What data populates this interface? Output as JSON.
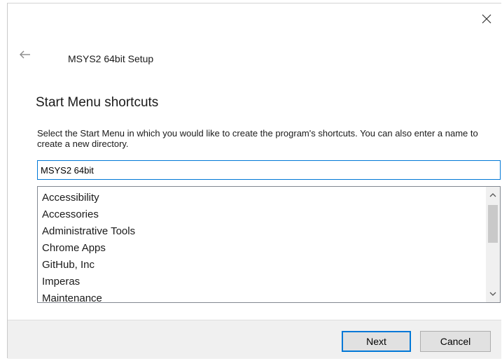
{
  "window": {
    "title": "MSYS2 64bit Setup",
    "close_icon": "close-icon",
    "back_icon": "back-arrow-icon"
  },
  "page": {
    "heading": "Start Menu shortcuts",
    "description": "Select the Start Menu in which you would like to create the program's shortcuts. You can also enter a name to create a new directory."
  },
  "folder_input": {
    "value": "MSYS2 64bit"
  },
  "folder_list": {
    "items": [
      "Accessibility",
      "Accessories",
      "Administrative Tools",
      "Chrome Apps",
      "GitHub, Inc",
      "Imperas",
      "Maintenance"
    ]
  },
  "footer": {
    "next_label": "Next",
    "cancel_label": "Cancel"
  },
  "colors": {
    "accent": "#0078d7",
    "footer_bg": "#f0f0f0",
    "button_bg": "#e1e1e1"
  }
}
